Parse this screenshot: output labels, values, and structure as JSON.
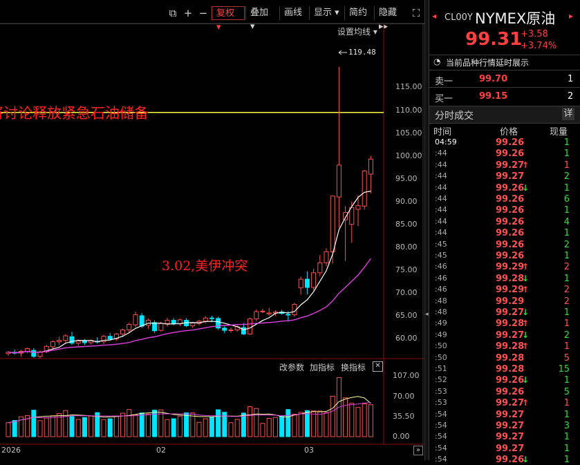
{
  "toolbar": {
    "buttons": [
      {
        "label": "复权",
        "active": true,
        "dropdown": true
      },
      {
        "label": "叠加",
        "dropdown": true
      },
      {
        "label": "画线"
      },
      {
        "label": "显示",
        "dropdown": true
      },
      {
        "label": "简约"
      },
      {
        "label": "隐藏"
      }
    ],
    "settings_label": "设置均线"
  },
  "chart": {
    "y_ticks": [
      "115.00",
      "110.00",
      "105.00",
      "100.00",
      "95.00",
      "90.00",
      "85.00",
      "80.00",
      "75.00",
      "70.00",
      "65.00",
      "60.00"
    ],
    "peak_label": "119.48",
    "annotation_1": "将讨论释放紧急石油储备",
    "annotation_2": "3.02,美伊冲突",
    "indicator_links": [
      "改参数",
      "加指标",
      "换指标"
    ],
    "vol_ticks": [
      "107.00",
      "70.00",
      "35.50",
      "0.00"
    ],
    "x_ticks": [
      "2026",
      "02",
      "03"
    ]
  },
  "chart_data": {
    "type": "candlestick",
    "ylim": [
      55,
      120
    ],
    "horizontal_line": 109.5,
    "candles": [
      [
        56.7,
        57.3,
        56.2,
        57.0
      ],
      [
        57.0,
        57.6,
        56.5,
        56.8
      ],
      [
        56.8,
        57.5,
        56.0,
        57.2
      ],
      [
        57.2,
        58.0,
        56.8,
        57.8
      ],
      [
        57.4,
        57.9,
        55.8,
        56.1
      ],
      [
        56.1,
        57.4,
        55.7,
        57.1
      ],
      [
        57.1,
        58.6,
        56.8,
        58.3
      ],
      [
        58.2,
        59.6,
        57.8,
        59.3
      ],
      [
        59.3,
        60.4,
        58.6,
        59.6
      ],
      [
        59.6,
        61.0,
        59.0,
        60.6
      ],
      [
        60.4,
        61.5,
        58.6,
        59.0
      ],
      [
        59.0,
        59.8,
        58.4,
        59.5
      ],
      [
        59.5,
        59.9,
        58.6,
        59.1
      ],
      [
        59.1,
        59.8,
        58.7,
        59.6
      ],
      [
        59.4,
        60.3,
        58.9,
        59.3
      ],
      [
        59.3,
        60.8,
        58.8,
        60.5
      ],
      [
        60.5,
        61.2,
        59.6,
        59.9
      ],
      [
        59.9,
        61.2,
        59.5,
        61.0
      ],
      [
        61.0,
        62.2,
        60.3,
        61.9
      ],
      [
        61.9,
        63.5,
        61.2,
        63.1
      ],
      [
        63.0,
        65.9,
        62.5,
        65.2
      ],
      [
        65.0,
        65.6,
        62.3,
        62.7
      ],
      [
        62.9,
        64.4,
        62.1,
        64.0
      ],
      [
        63.5,
        64.0,
        61.2,
        61.7
      ],
      [
        61.8,
        63.7,
        61.5,
        63.3
      ],
      [
        63.3,
        64.6,
        62.6,
        64.0
      ],
      [
        64.0,
        64.5,
        62.9,
        63.2
      ],
      [
        63.2,
        64.4,
        62.7,
        64.1
      ],
      [
        64.0,
        64.5,
        62.5,
        62.8
      ],
      [
        62.8,
        63.6,
        62.3,
        63.4
      ],
      [
        63.3,
        64.1,
        62.9,
        63.8
      ],
      [
        63.8,
        64.9,
        63.3,
        64.5
      ],
      [
        64.5,
        65.0,
        63.6,
        64.4
      ],
      [
        64.4,
        64.8,
        61.9,
        62.3
      ],
      [
        62.3,
        62.7,
        61.2,
        61.8
      ],
      [
        61.8,
        62.4,
        61.3,
        61.9
      ],
      [
        61.9,
        62.9,
        61.5,
        62.6
      ],
      [
        62.4,
        63.4,
        60.8,
        61.0
      ],
      [
        61.0,
        64.6,
        60.8,
        64.3
      ],
      [
        64.3,
        66.4,
        63.8,
        65.9
      ],
      [
        65.9,
        66.5,
        65.6,
        66.0
      ],
      [
        65.4,
        66.7,
        65.0,
        65.6
      ],
      [
        65.6,
        66.2,
        64.9,
        65.8
      ],
      [
        65.8,
        66.3,
        65.2,
        65.5
      ],
      [
        65.3,
        66.0,
        63.7,
        65.2
      ],
      [
        65.2,
        67.8,
        64.8,
        67.5
      ],
      [
        71.1,
        73.6,
        69.6,
        73.0
      ],
      [
        73.0,
        74.7,
        69.7,
        71.2
      ],
      [
        71.2,
        75.3,
        70.5,
        74.4
      ],
      [
        74.4,
        78.3,
        73.6,
        76.6
      ],
      [
        76.6,
        79.8,
        75.9,
        79.0
      ],
      [
        79.0,
        89.3,
        76.4,
        91.2
      ],
      [
        91.0,
        119.5,
        84.3,
        98.0
      ],
      [
        86.0,
        89.0,
        77.0,
        87.6
      ],
      [
        85.0,
        90.0,
        81.0,
        88.7
      ],
      [
        88.3,
        91.3,
        84.6,
        89.1
      ],
      [
        89.0,
        96.9,
        88.2,
        96.7
      ],
      [
        96.0,
        100.0,
        91.8,
        99.3
      ]
    ],
    "ma_fast": "white",
    "ma_slow": "magenta",
    "volume_ylim": [
      0,
      107
    ]
  },
  "panel": {
    "code": "CL00Y",
    "name": "NYMEX原油",
    "price": "99.31",
    "change": "+3.58",
    "change_pct": "+3.74%",
    "notice": "当前品种行情延时展示",
    "ask_label": "卖一",
    "ask_price": "99.70",
    "ask_vol": "1",
    "bid_label": "买一",
    "bid_price": "99.15",
    "bid_vol": "2",
    "ticks_title": "分时成交",
    "detail_label": "详",
    "col_time": "时间",
    "col_price": "价格",
    "col_vol": "现量",
    "ticks": [
      {
        "t": "04:59",
        "p": "99.26",
        "d": "",
        "v": "1",
        "pc": "#ff5050",
        "vc": "#30e030"
      },
      {
        "t": ":44",
        "p": "99.26",
        "d": "",
        "v": "1",
        "pc": "#ff5050",
        "vc": "#30e030"
      },
      {
        "t": ":44",
        "p": "99.27",
        "d": "up",
        "v": "1",
        "pc": "#ff5050",
        "vc": "#ff5050"
      },
      {
        "t": ":44",
        "p": "99.27",
        "d": "",
        "v": "2",
        "pc": "#ff5050",
        "vc": "#30e030"
      },
      {
        "t": ":44",
        "p": "99.26",
        "d": "down",
        "v": "1",
        "pc": "#ff5050",
        "vc": "#30e030"
      },
      {
        "t": ":44",
        "p": "99.26",
        "d": "",
        "v": "6",
        "pc": "#ff5050",
        "vc": "#30e030"
      },
      {
        "t": ":44",
        "p": "99.26",
        "d": "",
        "v": "1",
        "pc": "#ff5050",
        "vc": "#30e030"
      },
      {
        "t": ":44",
        "p": "99.26",
        "d": "",
        "v": "4",
        "pc": "#ff5050",
        "vc": "#30e030"
      },
      {
        "t": ":44",
        "p": "99.26",
        "d": "",
        "v": "1",
        "pc": "#ff5050",
        "vc": "#30e030"
      },
      {
        "t": ":45",
        "p": "99.26",
        "d": "",
        "v": "2",
        "pc": "#ff5050",
        "vc": "#30e030"
      },
      {
        "t": ":45",
        "p": "99.26",
        "d": "",
        "v": "1",
        "pc": "#ff5050",
        "vc": "#30e030"
      },
      {
        "t": ":46",
        "p": "99.29",
        "d": "up",
        "v": "2",
        "pc": "#ff5050",
        "vc": "#ff5050"
      },
      {
        "t": ":46",
        "p": "99.28",
        "d": "down",
        "v": "1",
        "pc": "#ff5050",
        "vc": "#30e030"
      },
      {
        "t": ":46",
        "p": "99.29",
        "d": "up",
        "v": "2",
        "pc": "#ff5050",
        "vc": "#ff5050"
      },
      {
        "t": ":48",
        "p": "99.29",
        "d": "",
        "v": "2",
        "pc": "#ff5050",
        "vc": "#ff5050"
      },
      {
        "t": ":48",
        "p": "99.27",
        "d": "down",
        "v": "1",
        "pc": "#ff5050",
        "vc": "#30e030"
      },
      {
        "t": ":49",
        "p": "99.28",
        "d": "up",
        "v": "1",
        "pc": "#ff5050",
        "vc": "#ff5050"
      },
      {
        "t": ":49",
        "p": "99.27",
        "d": "down",
        "v": "2",
        "pc": "#ff5050",
        "vc": "#30e030"
      },
      {
        "t": ":50",
        "p": "99.28",
        "d": "up",
        "v": "1",
        "pc": "#ff5050",
        "vc": "#ff5050"
      },
      {
        "t": ":50",
        "p": "99.28",
        "d": "",
        "v": "5",
        "pc": "#ff5050",
        "vc": "#ff5050"
      },
      {
        "t": ":51",
        "p": "99.28",
        "d": "",
        "v": "15",
        "pc": "#ff5050",
        "vc": "#30e030"
      },
      {
        "t": ":52",
        "p": "99.26",
        "d": "down",
        "v": "1",
        "pc": "#ff5050",
        "vc": "#30e030"
      },
      {
        "t": ":53",
        "p": "99.26",
        "d": "",
        "v": "5",
        "pc": "#ff5050",
        "vc": "#30e030"
      },
      {
        "t": ":53",
        "p": "99.27",
        "d": "up",
        "v": "1",
        "pc": "#ff5050",
        "vc": "#ff5050"
      },
      {
        "t": ":54",
        "p": "99.27",
        "d": "",
        "v": "1",
        "pc": "#ff5050",
        "vc": "#30e030"
      },
      {
        "t": ":54",
        "p": "99.27",
        "d": "",
        "v": "3",
        "pc": "#ff5050",
        "vc": "#30e030"
      },
      {
        "t": ":54",
        "p": "99.27",
        "d": "",
        "v": "1",
        "pc": "#ff5050",
        "vc": "#30e030"
      },
      {
        "t": ":54",
        "p": "99.27",
        "d": "",
        "v": "1",
        "pc": "#ff5050",
        "vc": "#30e030"
      },
      {
        "t": ":54",
        "p": "99.26",
        "d": "down",
        "v": "1",
        "pc": "#ff5050",
        "vc": "#30e030"
      }
    ]
  },
  "colors": {
    "up": "#ff5050",
    "down": "#00e5ff",
    "ma_fast": "#ffffff",
    "ma_slow": "#e040e0",
    "hline": "#ffff40"
  }
}
